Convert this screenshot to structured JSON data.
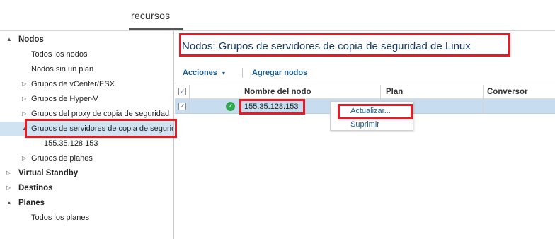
{
  "top_tab": {
    "label": "recursos"
  },
  "tree": {
    "items": [
      {
        "label": "Nodos",
        "arrow": "▲",
        "bold": true
      },
      {
        "label": "Todos los nodos"
      },
      {
        "label": "Nodos sin un plan"
      },
      {
        "label": "Grupos de vCenter/ESX",
        "arrow": "▷"
      },
      {
        "label": "Grupos de Hyper-V",
        "arrow": "▷"
      },
      {
        "label": "Grupos del proxy de copia de seguridad",
        "arrow": "▷"
      },
      {
        "label": "Grupos de servidores de copia de seguridad de Linux",
        "arrow": "▲",
        "selected": true
      },
      {
        "label": "155.35.128.153"
      },
      {
        "label": "Grupos de planes",
        "arrow": "▷"
      },
      {
        "label": "Virtual Standby",
        "arrow": "▷",
        "bold": true
      },
      {
        "label": "Destinos",
        "arrow": "▷",
        "bold": true
      },
      {
        "label": "Planes",
        "arrow": "▲",
        "bold": true
      },
      {
        "label": "Todos los planes"
      }
    ]
  },
  "panel": {
    "title": "Nodos:  Grupos de servidores de copia de seguridad de Linux"
  },
  "toolbar": {
    "actions_label": "Acciones",
    "actions_caret": "▾",
    "add_nodes_label": "Agregar nodos"
  },
  "grid": {
    "columns": [
      "Nombre del nodo",
      "Plan",
      "Conversor"
    ],
    "rows": [
      {
        "node": "155.35.128.153",
        "plan": "",
        "converter": "",
        "status": "ok",
        "checked": true
      }
    ]
  },
  "context_menu": {
    "items": [
      "Actualizar...",
      "Suprimir"
    ]
  },
  "colors": {
    "highlight": "#e51c23",
    "selection": "#c7ddef",
    "link": "#1a5d94",
    "title": "#1b3a66"
  }
}
